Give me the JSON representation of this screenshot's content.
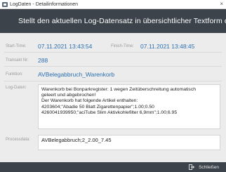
{
  "window": {
    "title": "LogDaten",
    "separator": "-",
    "subtitle": "Detailinformationen",
    "close_glyph": "×"
  },
  "banner": {
    "icon": "database-icon",
    "headline": "Stellt den aktuellen Log-Datensatz in übersichtlicher Textform dar."
  },
  "fields": {
    "start_label": "Start-Time:",
    "start_value": "07.11.2021 13:43:54",
    "finish_label": "Finish-Time:",
    "finish_value": "07.11.2021 13:48:45",
    "transaction_label": "Transakt Nr:",
    "transaction_value": "288",
    "function_label": "Funktion:",
    "function_value": "AVBelegabbruch_Warenkorb",
    "log_label": "Log-Daten:",
    "log_lines": [
      "Warenkorb bei Bonparkregister: 1 wegen Zeitüberschreitung automatisch",
      "geleert und abgebrochen!",
      "Der Warenkorb hat folgende Artikel enthalten:",
      "4203604;\"Abadie 50 Blatt Zigarettenpapier\";1.00;0.50",
      "4260041939950;\"aciTube Slim Aktivkohlefilter 6,9mm\";1.00;6.95"
    ],
    "process_label": "Processdata:",
    "process_value": "AVBelegabbruch;2_2.00_7.45"
  },
  "footer": {
    "close_label": "Schließen",
    "close_icon": "exit-icon"
  },
  "colors": {
    "banner_bg": "#3c434b",
    "value_blue": "#2a6fb2"
  }
}
